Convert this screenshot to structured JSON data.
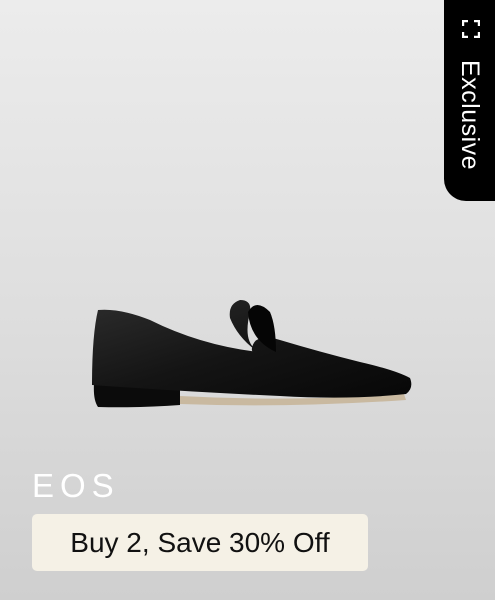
{
  "badge": {
    "label": "Exclusive",
    "icon": "expand-corners-icon"
  },
  "product": {
    "brand": "EOS",
    "image_alt": "black velvet loafer shoe"
  },
  "promo": {
    "label": "Buy 2, Save 30% Off"
  },
  "colors": {
    "badge_bg": "#000000",
    "promo_bg": "#f5f1e6",
    "brand_text": "#ffffff"
  }
}
